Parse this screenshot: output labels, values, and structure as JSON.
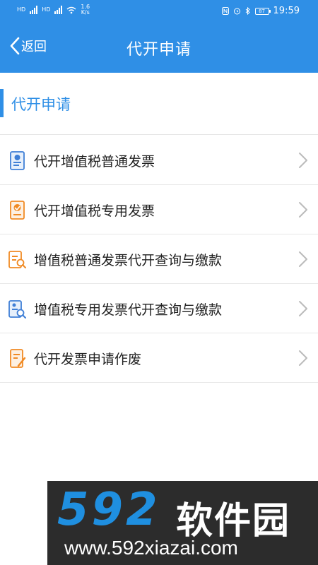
{
  "status_bar": {
    "left_small_1": "HD",
    "left_small_2": "HD",
    "net_speed_value": "1.6",
    "net_speed_unit": "K/s",
    "battery": "87",
    "time": "19:59"
  },
  "nav": {
    "back_label": "返回",
    "title": "代开申请"
  },
  "section": {
    "title": "代开申请"
  },
  "list": {
    "items": [
      {
        "label": "代开增值税普通发票",
        "icon": "invoice-doc-icon",
        "color": "#3f7fd6"
      },
      {
        "label": "代开增值税专用发票",
        "icon": "invoice-badge-icon",
        "color": "#f08a24"
      },
      {
        "label": "增值税普通发票代开查询与缴款",
        "icon": "search-document-icon",
        "color": "#f08a24"
      },
      {
        "label": "增值税专用发票代开查询与缴款",
        "icon": "search-list-icon",
        "color": "#3f7fd6"
      },
      {
        "label": "代开发票申请作废",
        "icon": "document-cancel-icon",
        "color": "#f08a24"
      }
    ]
  },
  "watermark": {
    "logo_num": "592",
    "logo_cn": "软件园",
    "url": "www.592xiazai.com"
  },
  "colors": {
    "primary": "#2f8fe6",
    "icon_blue": "#3f7fd6",
    "icon_orange": "#f08a24"
  }
}
